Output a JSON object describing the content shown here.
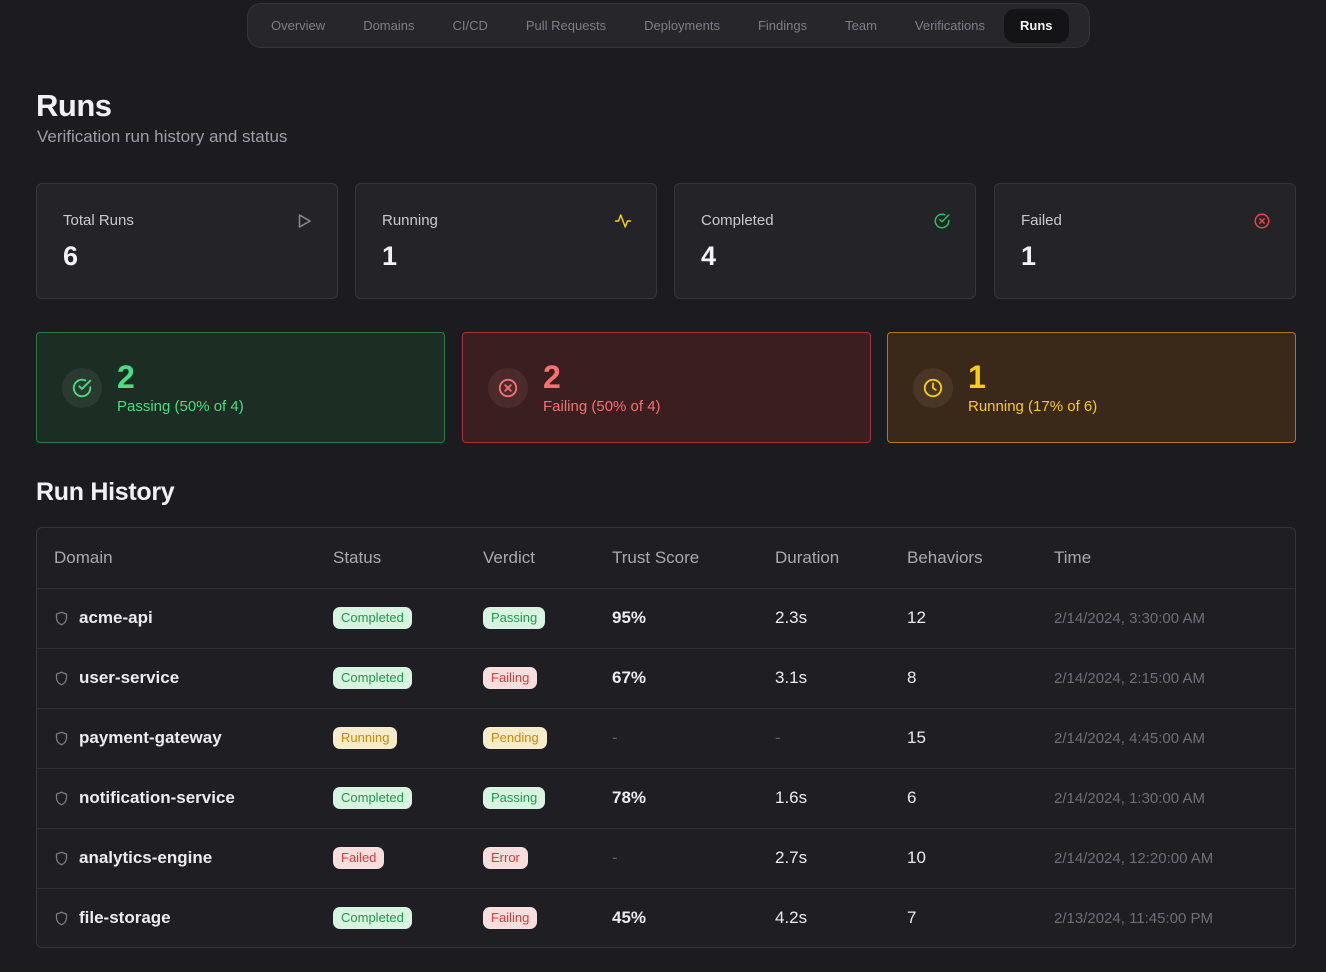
{
  "nav": {
    "tabs": [
      "Overview",
      "Domains",
      "CI/CD",
      "Pull Requests",
      "Deployments",
      "Findings",
      "Team",
      "Verifications",
      "Runs"
    ],
    "active": "Runs"
  },
  "header": {
    "title": "Runs",
    "subtitle": "Verification run history and status"
  },
  "stats": [
    {
      "label": "Total Runs",
      "value": "6",
      "icon": "play-icon",
      "color": "#8a8a94"
    },
    {
      "label": "Running",
      "value": "1",
      "icon": "activity-icon",
      "color": "#facc15"
    },
    {
      "label": "Completed",
      "value": "4",
      "icon": "check-circle-icon",
      "color": "#22c55e"
    },
    {
      "label": "Failed",
      "value": "1",
      "icon": "x-circle-icon",
      "color": "#ef4444"
    }
  ],
  "summary": {
    "passing": {
      "value": "2",
      "caption": "Passing (50% of 4)"
    },
    "failing": {
      "value": "2",
      "caption": "Failing (50% of 4)"
    },
    "running": {
      "value": "1",
      "caption": "Running (17% of 6)"
    }
  },
  "history": {
    "title": "Run History",
    "columns": [
      "Domain",
      "Status",
      "Verdict",
      "Trust Score",
      "Duration",
      "Behaviors",
      "Time"
    ],
    "rows": [
      {
        "domain": "acme-api",
        "status": "Completed",
        "status_color": "green",
        "verdict": "Passing",
        "verdict_color": "green",
        "trust": "95%",
        "duration": "2.3s",
        "behaviors": "12",
        "time": "2/14/2024, 3:30:00 AM"
      },
      {
        "domain": "user-service",
        "status": "Completed",
        "status_color": "green",
        "verdict": "Failing",
        "verdict_color": "red",
        "trust": "67%",
        "duration": "3.1s",
        "behaviors": "8",
        "time": "2/14/2024, 2:15:00 AM"
      },
      {
        "domain": "payment-gateway",
        "status": "Running",
        "status_color": "yellow",
        "verdict": "Pending",
        "verdict_color": "yellow",
        "trust": "-",
        "duration": "-",
        "behaviors": "15",
        "time": "2/14/2024, 4:45:00 AM"
      },
      {
        "domain": "notification-service",
        "status": "Completed",
        "status_color": "green",
        "verdict": "Passing",
        "verdict_color": "green",
        "trust": "78%",
        "duration": "1.6s",
        "behaviors": "6",
        "time": "2/14/2024, 1:30:00 AM"
      },
      {
        "domain": "analytics-engine",
        "status": "Failed",
        "status_color": "red",
        "verdict": "Error",
        "verdict_color": "red",
        "trust": "-",
        "duration": "2.7s",
        "behaviors": "10",
        "time": "2/14/2024, 12:20:00 AM"
      },
      {
        "domain": "file-storage",
        "status": "Completed",
        "status_color": "green",
        "verdict": "Failing",
        "verdict_color": "red",
        "trust": "45%",
        "duration": "4.2s",
        "behaviors": "7",
        "time": "2/13/2024, 11:45:00 PM"
      }
    ]
  }
}
